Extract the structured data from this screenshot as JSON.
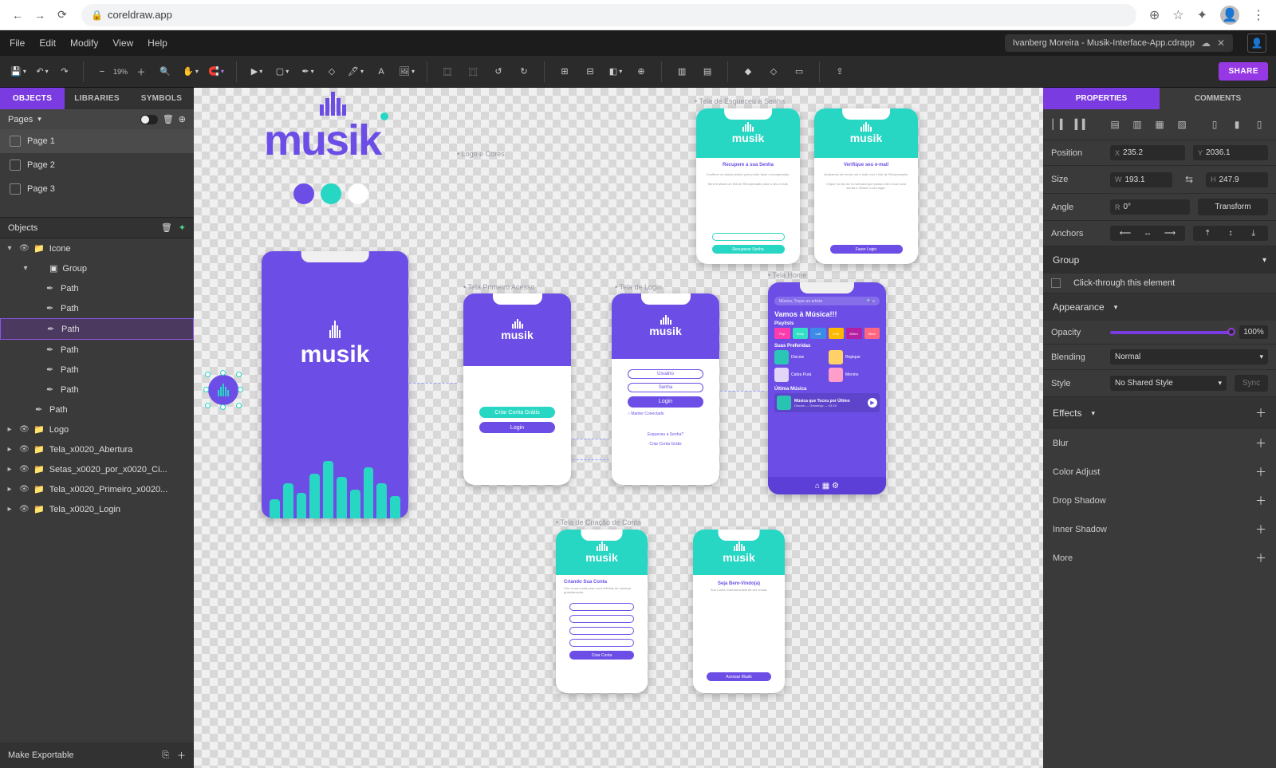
{
  "browser": {
    "url": "coreldraw.app"
  },
  "menubar": {
    "items": [
      "File",
      "Edit",
      "Modify",
      "View",
      "Help"
    ],
    "doc": "Ivanberg Moreira - Musik-Interface-App.cdrapp"
  },
  "toolbar": {
    "zoom": "19%",
    "share": "SHARE"
  },
  "left_tabs": [
    "OBJECTS",
    "LIBRARIES",
    "SYMBOLS"
  ],
  "pages": {
    "header": "Pages",
    "items": [
      "Page 1",
      "Page 2",
      "Page 3"
    ]
  },
  "objects_header": "Objects",
  "tree": {
    "root": "Icone",
    "group": "Group",
    "paths": [
      "Path",
      "Path",
      "Path",
      "Path",
      "Path",
      "Path",
      "Path"
    ],
    "layers": [
      "Logo",
      "Tela_x0020_Abertura",
      "Setas_x0020_por_x0020_Ci...",
      "Tela_x0020_Primeiro_x0020...",
      "Tela_x0020_Login"
    ]
  },
  "make_exportable": "Make Exportable",
  "right_tabs": [
    "PROPERTIES",
    "COMMENTS"
  ],
  "props": {
    "position_label": "Position",
    "x": "235.2",
    "y": "2036.1",
    "size_label": "Size",
    "w": "193.1",
    "h": "247.9",
    "angle_label": "Angle",
    "angle": "0°",
    "transform": "Transform",
    "anchors_label": "Anchors",
    "type": "Group",
    "clickthrough": "Click-through this element",
    "appearance": "Appearance",
    "opacity_label": "Opacity",
    "opacity": "100%",
    "blending_label": "Blending",
    "blending": "Normal",
    "style_label": "Style",
    "style": "No Shared Style",
    "sync": "Sync",
    "effects_label": "Effects",
    "effects": [
      "Blur",
      "Color Adjust",
      "Drop Shadow",
      "Inner Shadow",
      "More"
    ]
  },
  "canvas": {
    "labels": {
      "logo": "• Logo e Cores",
      "primeiro": "• Tela Primeiro Acesso",
      "login": "• Tela de Login",
      "home": "• Tela Home",
      "esqueceu": "• Tela de Esqueceu a Senha",
      "criacao": "• Tela de Criação de Conta"
    },
    "screens": {
      "primeiro": {
        "btn1": "Criar Conta Grátis",
        "btn2": "Login"
      },
      "login": {
        "f1": "Usuário",
        "f2": "Senha",
        "btn": "Login",
        "keep": "Manter Conectado",
        "forgot": "Esqueceu a Senha?",
        "create": "Criar Conta Grátis"
      },
      "recover": {
        "title": "Recupere a sua Senha",
        "btn": "Recuperar Senha"
      },
      "verify": {
        "title": "Verifique seu e-mail",
        "btn": "Fazer Login"
      },
      "home": {
        "search": "Música, Toque ao artista",
        "headline": "Vamos à Música!!!",
        "playlists": "Playlists",
        "pl": [
          "Pop",
          "Rock",
          "Lofi",
          "Chill",
          "Eletro",
          "More"
        ],
        "pref": "Suas Preferidas",
        "songs": [
          "Discow",
          "Repique",
          "Catira Purá",
          "Menino"
        ],
        "last": "Última Música",
        "lastTitle": "Música que Tocou por Último",
        "lastMeta": "Discow — Grammys — 03:15"
      },
      "create": {
        "title": "Criando Sua Conta",
        "sub": "Crie a sua conta para ouvir milhões de músicas gratuitamente",
        "btn": "Criar Conta"
      },
      "welcome": {
        "title": "Seja Bem-Vindo(a)",
        "sub": "Sua Conta Gratuita acaba de ser criada.",
        "btn": "Acessar Musik"
      }
    },
    "brand": "musik"
  }
}
